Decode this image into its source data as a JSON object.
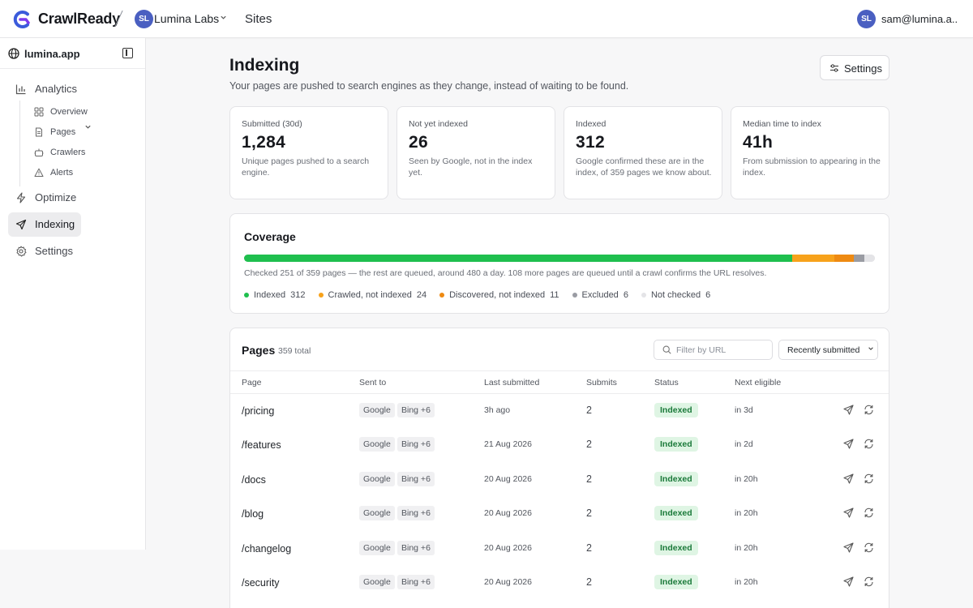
{
  "topbar": {
    "brand": "CrawlReady",
    "org_initials": "SL",
    "org_name": "Lumina Labs",
    "section": "Sites",
    "user_initials": "SL",
    "user_email": "sam@lumina.a..."
  },
  "sidebar": {
    "site": "lumina.app",
    "items": {
      "analytics": "Analytics",
      "overview": "Overview",
      "pages": "Pages",
      "crawlers": "Crawlers",
      "alerts": "Alerts",
      "optimize": "Optimize",
      "indexing": "Indexing",
      "settings": "Settings"
    }
  },
  "header": {
    "title": "Indexing",
    "subtitle": "Your pages are pushed to search engines as they change, instead of waiting to be found.",
    "settings_label": "Settings"
  },
  "stats": [
    {
      "label": "Submitted (30d)",
      "value": "1,284",
      "desc": "Unique pages pushed to a search engine."
    },
    {
      "label": "Not yet indexed",
      "value": "26",
      "desc": "Seen by Google, not in the index yet."
    },
    {
      "label": "Indexed",
      "value": "312",
      "desc": "Google confirmed these are in the index, of 359 pages we know about."
    },
    {
      "label": "Median time to index",
      "value": "41h",
      "desc": "From submission to appearing in the index."
    }
  ],
  "coverage": {
    "title": "Coverage",
    "note": "Checked 251 of 359 pages — the rest are queued, around 480 a day. 108 more pages are queued until a crawl confirms the URL resolves.",
    "segments": [
      {
        "label": "Indexed",
        "count": "312",
        "value": 312,
        "color": "#1fbf4e"
      },
      {
        "label": "Crawled, not indexed",
        "count": "24",
        "value": 24,
        "color": "#f7a21b"
      },
      {
        "label": "Discovered, not indexed",
        "count": "11",
        "value": 11,
        "color": "#ee8a12"
      },
      {
        "label": "Excluded",
        "count": "6",
        "value": 6,
        "color": "#9a9ca3"
      },
      {
        "label": "Not checked",
        "count": "6",
        "value": 6,
        "color": "#e4e4e7"
      }
    ]
  },
  "pages": {
    "title": "Pages",
    "total": "359 total",
    "filter_placeholder": "Filter by URL",
    "sort_label": "Recently submitted",
    "columns": {
      "page": "Page",
      "sent_to": "Sent to",
      "last": "Last submitted",
      "submits": "Submits",
      "status": "Status",
      "next": "Next eligible"
    },
    "rows": [
      {
        "path": "/pricing",
        "engine1": "Google",
        "engine2": "Bing +6",
        "last": "3h ago",
        "submits": "2",
        "status": "Indexed",
        "next": "in 3d"
      },
      {
        "path": "/features",
        "engine1": "Google",
        "engine2": "Bing +6",
        "last": "21 Aug 2026",
        "submits": "2",
        "status": "Indexed",
        "next": "in 2d"
      },
      {
        "path": "/docs",
        "engine1": "Google",
        "engine2": "Bing +6",
        "last": "20 Aug 2026",
        "submits": "2",
        "status": "Indexed",
        "next": "in 20h"
      },
      {
        "path": "/blog",
        "engine1": "Google",
        "engine2": "Bing +6",
        "last": "20 Aug 2026",
        "submits": "2",
        "status": "Indexed",
        "next": "in 20h"
      },
      {
        "path": "/changelog",
        "engine1": "Google",
        "engine2": "Bing +6",
        "last": "20 Aug 2026",
        "submits": "2",
        "status": "Indexed",
        "next": "in 20h"
      },
      {
        "path": "/security",
        "engine1": "Google",
        "engine2": "Bing +6",
        "last": "20 Aug 2026",
        "submits": "2",
        "status": "Indexed",
        "next": "in 20h"
      }
    ]
  }
}
